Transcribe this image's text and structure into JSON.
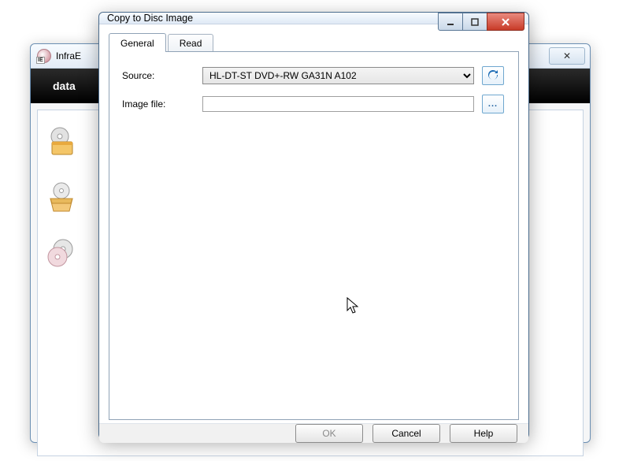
{
  "back_window": {
    "title": "InfraE",
    "ribbon_label": "data",
    "close_glyph": "✕"
  },
  "dialog": {
    "title": "Copy to Disc Image",
    "tabs": [
      {
        "label": "General",
        "active": true
      },
      {
        "label": "Read",
        "active": false
      }
    ],
    "form": {
      "source_label": "Source:",
      "source_value": "HL-DT-ST DVD+-RW GA31N A102",
      "image_label": "Image file:",
      "image_value": "",
      "browse_glyph": "..."
    },
    "buttons": {
      "ok": "OK",
      "cancel": "Cancel",
      "help": "Help"
    }
  }
}
